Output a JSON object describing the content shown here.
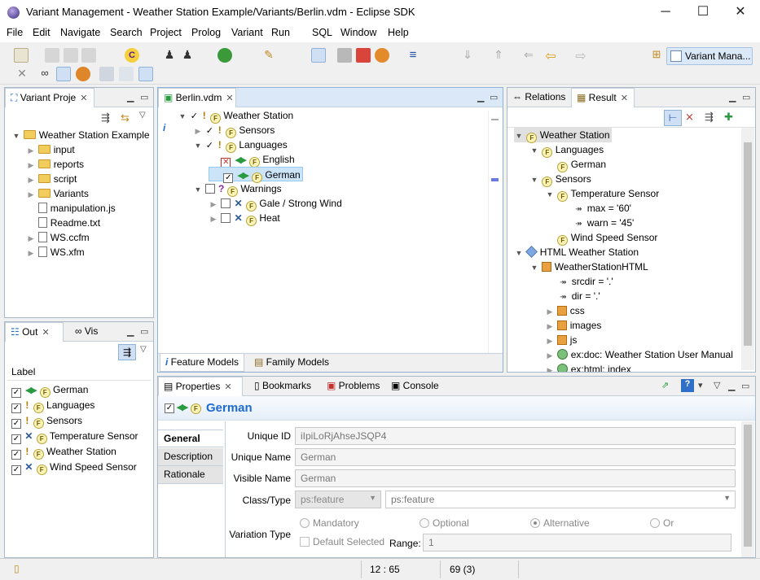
{
  "window": {
    "title": "Variant Management - Weather Station Example/Variants/Berlin.vdm - Eclipse SDK",
    "minimize": "─",
    "maximize": "☐",
    "close": "✕"
  },
  "menu": [
    "File",
    "Edit",
    "Navigate",
    "Search",
    "Project",
    "Prolog",
    "Variant",
    "Run",
    "SQL",
    "Window",
    "Help"
  ],
  "perspective": {
    "label": "Variant Mana..."
  },
  "project_view": {
    "tab": "Variant Proje",
    "items": [
      {
        "label": "Weather Station Example",
        "kind": "project",
        "depth": 0,
        "expanded": true
      },
      {
        "label": "input",
        "kind": "folder",
        "depth": 1
      },
      {
        "label": "reports",
        "kind": "folder",
        "depth": 1
      },
      {
        "label": "script",
        "kind": "folder",
        "depth": 1
      },
      {
        "label": "Variants",
        "kind": "folder",
        "depth": 1
      },
      {
        "label": "manipulation.js",
        "kind": "file",
        "depth": 1
      },
      {
        "label": "Readme.txt",
        "kind": "file",
        "depth": 1
      },
      {
        "label": "WS.ccfm",
        "kind": "file",
        "depth": 1
      },
      {
        "label": "WS.xfm",
        "kind": "file",
        "depth": 1
      }
    ]
  },
  "outline": {
    "tabs": [
      "Out",
      "Vis"
    ],
    "column_label": "Label",
    "rows": [
      {
        "label": "German",
        "mark": "check",
        "state": "dbl"
      },
      {
        "label": "Languages",
        "mark": "check",
        "state": "excl"
      },
      {
        "label": "Sensors",
        "mark": "check",
        "state": "excl"
      },
      {
        "label": "Temperature Sensor",
        "mark": "check",
        "state": "x"
      },
      {
        "label": "Weather Station",
        "mark": "check",
        "state": "excl"
      },
      {
        "label": "Wind Speed Sensor",
        "mark": "check",
        "state": "x"
      }
    ]
  },
  "editor": {
    "tab": "Berlin.vdm",
    "bottom_tabs": [
      "Feature Models",
      "Family Models"
    ],
    "tree": [
      {
        "label": "Weather Station",
        "depth": 0,
        "twisty": "open",
        "tick": "✓",
        "state": "excl"
      },
      {
        "label": "Sensors",
        "depth": 1,
        "twisty": "closed",
        "tick": "✓",
        "state": "excl"
      },
      {
        "label": "Languages",
        "depth": 1,
        "twisty": "open",
        "tick": "✓",
        "state": "excl"
      },
      {
        "label": "English",
        "depth": 2,
        "twisty": "",
        "box": "x",
        "state": "dbl"
      },
      {
        "label": "German",
        "depth": 2,
        "twisty": "",
        "box": "check",
        "state": "dbl",
        "selected": true
      },
      {
        "label": "Warnings",
        "depth": 1,
        "twisty": "open",
        "box": "empty",
        "state": "q"
      },
      {
        "label": "Gale / Strong Wind",
        "depth": 2,
        "twisty": "closed",
        "box": "empty",
        "state": "x"
      },
      {
        "label": "Heat",
        "depth": 2,
        "twisty": "closed",
        "box": "empty",
        "state": "x"
      }
    ]
  },
  "result_view": {
    "tabs": [
      "Relations",
      "Result"
    ],
    "tree": [
      {
        "label": "Weather Station",
        "depth": 0,
        "twisty": "open",
        "icon": "F",
        "highlight": true
      },
      {
        "label": "Languages",
        "depth": 1,
        "twisty": "open",
        "icon": "F"
      },
      {
        "label": "German",
        "depth": 2,
        "twisty": "",
        "icon": "F"
      },
      {
        "label": "Sensors",
        "depth": 1,
        "twisty": "open",
        "icon": "F"
      },
      {
        "label": "Temperature Sensor",
        "depth": 2,
        "twisty": "open",
        "icon": "F"
      },
      {
        "label": "max = '60'",
        "depth": 3,
        "twisty": "",
        "icon": "attr"
      },
      {
        "label": "warn = '45'",
        "depth": 3,
        "twisty": "",
        "icon": "attr"
      },
      {
        "label": "Wind Speed Sensor",
        "depth": 2,
        "twisty": "",
        "icon": "F"
      },
      {
        "label": "HTML Weather Station",
        "depth": 0,
        "twisty": "open",
        "icon": "cube"
      },
      {
        "label": "WeatherStationHTML",
        "depth": 1,
        "twisty": "open",
        "icon": "grid"
      },
      {
        "label": "srcdir = '.'",
        "depth": 2,
        "twisty": "",
        "icon": "attrF"
      },
      {
        "label": "dir = '.'",
        "depth": 2,
        "twisty": "",
        "icon": "attrF"
      },
      {
        "label": "css",
        "depth": 2,
        "twisty": "closed",
        "icon": "grid"
      },
      {
        "label": "images",
        "depth": 2,
        "twisty": "closed",
        "icon": "grid"
      },
      {
        "label": "js",
        "depth": 2,
        "twisty": "closed",
        "icon": "grid"
      },
      {
        "label": "ex:doc: Weather Station User Manual",
        "depth": 2,
        "twisty": "closed",
        "icon": "doc"
      },
      {
        "label": "ex:html: index",
        "depth": 2,
        "twisty": "closed",
        "icon": "doc"
      }
    ]
  },
  "properties": {
    "tabs": [
      "Properties",
      "Bookmarks",
      "Problems",
      "Console"
    ],
    "heading": "German",
    "side_tabs": [
      "General",
      "Description",
      "Rationale"
    ],
    "labels": {
      "unique_id": "Unique ID",
      "unique_name": "Unique Name",
      "visible_name": "Visible Name",
      "class_type": "Class/Type",
      "variation_type": "Variation Type",
      "range": "Range:"
    },
    "values": {
      "unique_id": "iIpiLoRjAhseJSQP4",
      "unique_name": "German",
      "visible_name": "German",
      "class": "ps:feature",
      "type": "ps:feature",
      "range": "1"
    },
    "variation_options": [
      "Mandatory",
      "Optional",
      "Alternative",
      "Or"
    ],
    "variation_selected": "Alternative",
    "default_selected": "Default Selected",
    "help": "?"
  },
  "status": {
    "position": "12 : 65",
    "count": "69 (3)"
  },
  "colors": {
    "accent": "#1e6bd0",
    "selection": "#cce4f7",
    "feature_icon": "#fbf3b5"
  }
}
